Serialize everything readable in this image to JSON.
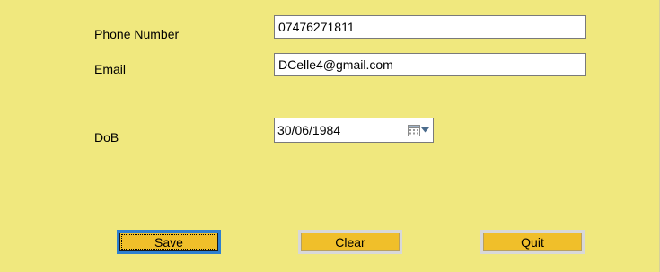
{
  "form": {
    "phone": {
      "label": "Phone Number",
      "value": "07476271811"
    },
    "email": {
      "label": "Email",
      "value": "DCelle4@gmail.com"
    },
    "dob": {
      "label": "DoB",
      "value": "30/06/1984"
    }
  },
  "buttons": {
    "save": "Save",
    "clear": "Clear",
    "quit": "Quit"
  },
  "colors": {
    "background": "#f0e87e",
    "button_fill": "#f0bf2a",
    "focus_border": "#2e7fd0"
  },
  "icons": {
    "calendar": "calendar-icon",
    "dropdown": "chevron-down-icon"
  },
  "focused_button": "save"
}
